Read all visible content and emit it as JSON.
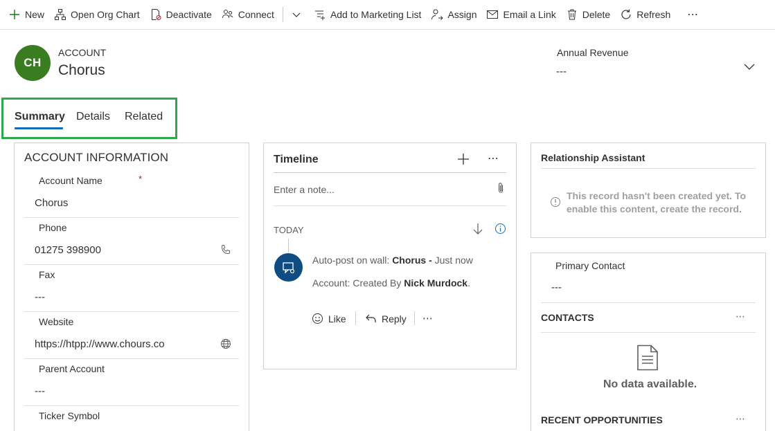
{
  "commands": {
    "new": "New",
    "open_org_chart": "Open Org Chart",
    "deactivate": "Deactivate",
    "connect": "Connect",
    "add_to_marketing_list": "Add to Marketing List",
    "assign": "Assign",
    "email_link": "Email a Link",
    "delete": "Delete",
    "refresh": "Refresh",
    "more": "⋯"
  },
  "header": {
    "avatar_initials": "CH",
    "avatar_color": "#3a7d21",
    "entity_type": "ACCOUNT",
    "record_name": "Chorus",
    "annual_revenue_label": "Annual Revenue",
    "annual_revenue_value": "---"
  },
  "tabs": [
    {
      "label": "Summary",
      "active": true
    },
    {
      "label": "Details",
      "active": false
    },
    {
      "label": "Related",
      "active": false
    }
  ],
  "account_info": {
    "title": "ACCOUNT INFORMATION",
    "fields": [
      {
        "label": "Account Name",
        "required_marker": "*",
        "value": "Chorus"
      },
      {
        "label": "Phone",
        "value": "01275 398900"
      },
      {
        "label": "Fax",
        "value": "---"
      },
      {
        "label": "Website",
        "value": "https://htpp://www.chours.co"
      },
      {
        "label": "Parent Account",
        "value": "---"
      },
      {
        "label": "Ticker Symbol",
        "value": ""
      }
    ]
  },
  "timeline": {
    "title": "Timeline",
    "more": "⋯",
    "note_placeholder": "Enter a note...",
    "group_label": "TODAY",
    "post": {
      "prefix": "Auto-post on wall:",
      "record": "Chorus -",
      "time": "Just now",
      "line2_prefix": "Account: Created By",
      "author": "Nick Murdock",
      "line2_suffix": "."
    },
    "actions": {
      "like": "Like",
      "reply": "Reply",
      "more": "⋯"
    }
  },
  "relationship_assistant": {
    "title": "Relationship Assistant",
    "message": "This record hasn't been created yet. To enable this content, create the record."
  },
  "right_panel": {
    "primary_contact_label": "Primary Contact",
    "primary_contact_value": "---",
    "contacts_title": "CONTACTS",
    "contacts_more": "⋯",
    "no_data": "No data available.",
    "recent_opportunities_title": "RECENT OPPORTUNITIES",
    "opportunities_more": "⋯"
  },
  "colors": {
    "accent": "#0f6cbd",
    "tab_highlight": "#2ea84a",
    "required": "#a4262c",
    "post_icon": "#0f4c81"
  }
}
